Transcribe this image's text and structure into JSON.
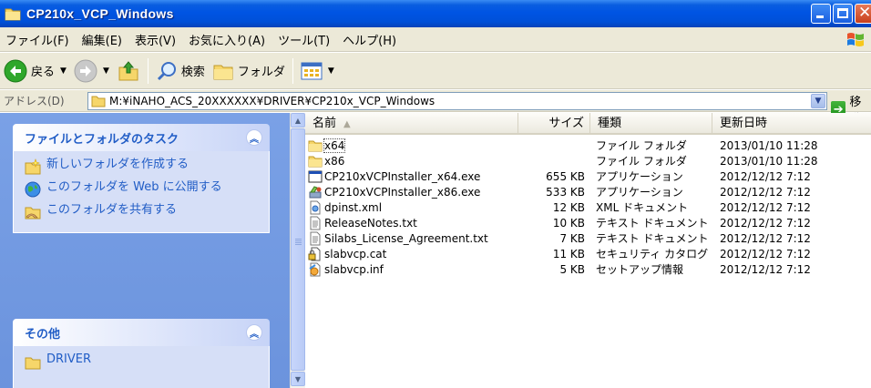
{
  "window": {
    "title": "CP210x_VCP_Windows"
  },
  "menu": [
    "ファイル(F)",
    "編集(E)",
    "表示(V)",
    "お気に入り(A)",
    "ツール(T)",
    "ヘルプ(H)"
  ],
  "toolbar": {
    "back_label": "戻る",
    "search_label": "検索",
    "folders_label": "フォルダ"
  },
  "address": {
    "label": "アドレス(D)",
    "path": "M:¥iNAHO_ACS_20XXXXXX¥DRIVER¥CP210x_VCP_Windows",
    "go_label": "移動"
  },
  "tasks_panel": {
    "title": "ファイルとフォルダのタスク",
    "items": [
      {
        "label": "新しいフォルダを作成する",
        "icon": "new-folder-icon"
      },
      {
        "label": "このフォルダを Web に公開する",
        "icon": "publish-web-icon"
      },
      {
        "label": "このフォルダを共有する",
        "icon": "share-folder-icon"
      }
    ]
  },
  "other_panel": {
    "title": "その他",
    "items": [
      {
        "label": "DRIVER",
        "icon": "folder-icon"
      }
    ]
  },
  "columns": {
    "name": "名前",
    "size": "サイズ",
    "type": "種類",
    "modified": "更新日時"
  },
  "files": [
    {
      "name": "x64",
      "size": "",
      "type": "ファイル フォルダ",
      "modified": "2013/01/10 11:28",
      "icon": "folder-icon"
    },
    {
      "name": "x86",
      "size": "",
      "type": "ファイル フォルダ",
      "modified": "2013/01/10 11:28",
      "icon": "folder-icon"
    },
    {
      "name": "CP210xVCPInstaller_x64.exe",
      "size": "655 KB",
      "type": "アプリケーション",
      "modified": "2012/12/12 7:12",
      "icon": "application-window-icon"
    },
    {
      "name": "CP210xVCPInstaller_x86.exe",
      "size": "533 KB",
      "type": "アプリケーション",
      "modified": "2012/12/12 7:12",
      "icon": "installer-icon"
    },
    {
      "name": "dpinst.xml",
      "size": "12 KB",
      "type": "XML ドキュメント",
      "modified": "2012/12/12 7:12",
      "icon": "xml-file-icon"
    },
    {
      "name": "ReleaseNotes.txt",
      "size": "10 KB",
      "type": "テキスト ドキュメント",
      "modified": "2012/12/12 7:12",
      "icon": "text-file-icon"
    },
    {
      "name": "Silabs_License_Agreement.txt",
      "size": "7 KB",
      "type": "テキスト ドキュメント",
      "modified": "2012/12/12 7:12",
      "icon": "text-file-icon"
    },
    {
      "name": "slabvcp.cat",
      "size": "11 KB",
      "type": "セキュリティ カタログ",
      "modified": "2012/12/12 7:12",
      "icon": "security-catalog-icon"
    },
    {
      "name": "slabvcp.inf",
      "size": "5 KB",
      "type": "セットアップ情報",
      "modified": "2012/12/12 7:12",
      "icon": "setup-info-icon"
    }
  ],
  "colors": {
    "titlebar": "#0054e3",
    "taskpane": "#7aa1e6",
    "link": "#215dc6"
  }
}
